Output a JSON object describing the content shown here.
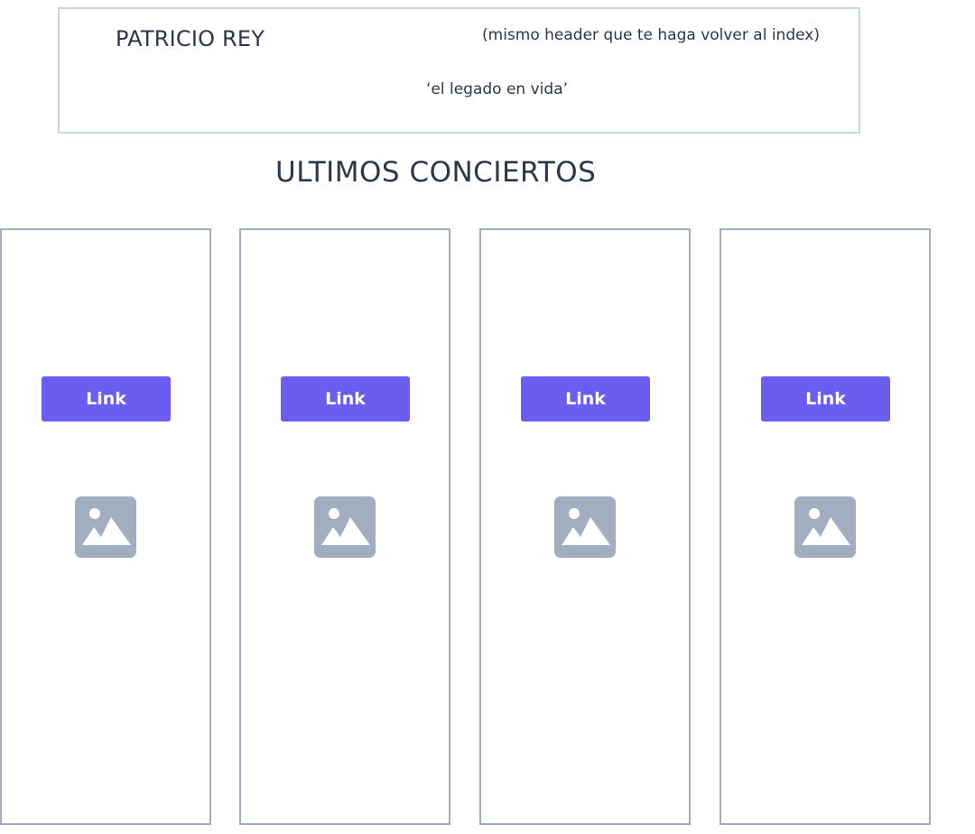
{
  "header": {
    "brand": "PATRICIO REY",
    "note": "(mismo header que te haga volver al index)",
    "tagline": "‘el legado en vida’"
  },
  "main": {
    "section_title": "ULTIMOS CONCIERTOS",
    "cards": [
      {
        "button_label": "Link",
        "image_icon": "image-placeholder-icon"
      },
      {
        "button_label": "Link",
        "image_icon": "image-placeholder-icon"
      },
      {
        "button_label": "Link",
        "image_icon": "image-placeholder-icon"
      },
      {
        "button_label": "Link",
        "image_icon": "image-placeholder-icon"
      }
    ]
  },
  "colors": {
    "button": "#6b5cf2",
    "card_border": "#a0aec0",
    "header_border": "#cbd5e0",
    "icon": "#a0aec0",
    "text": "#2d3748"
  }
}
